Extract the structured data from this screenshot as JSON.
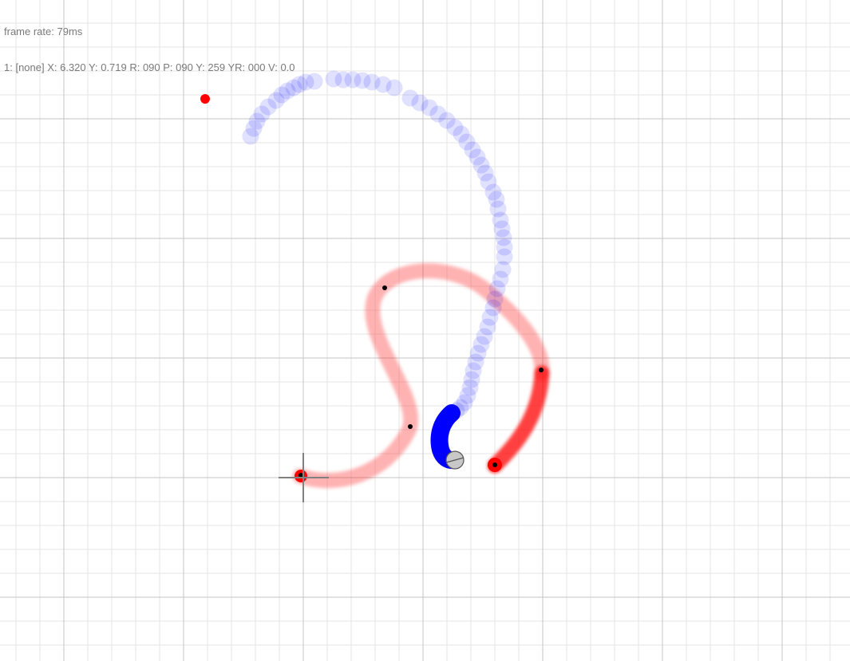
{
  "hud": {
    "frame_rate_label": "frame rate:",
    "frame_rate_value": "79ms",
    "status_line": "1: [none] X: 6.320 Y: 0.719 R: 090 P: 090 Y: 259 YR: 000 V: 0.0"
  },
  "colors": {
    "background": "#ffffff",
    "grid_minor": "#e6e6e6",
    "grid_major": "#c4c4c4",
    "path_red": "#ff0000",
    "trail_blue": "#0000ff",
    "waypoint_dot": "#000000",
    "target_dot": "#ff0000",
    "crosshair": "#808080",
    "robot_fill": "#c8c8c8",
    "robot_stroke": "#555555"
  },
  "icons": {
    "robot": "robot-marker-icon",
    "origin": "crosshair-icon",
    "target": "target-dot-icon",
    "waypoint": "waypoint-dot-icon"
  }
}
